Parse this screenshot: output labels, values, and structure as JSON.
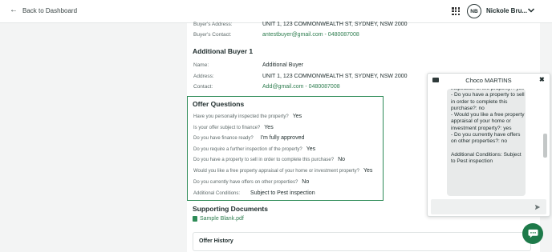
{
  "topbar": {
    "back_label": "Back to Dashboard",
    "avatar_initials": "NB",
    "username": "Nickole Bru..."
  },
  "buyer": {
    "address_label": "Buyer's Address:",
    "address": "UNIT 1, 123 COMMONWEALTH ST, SYDNEY, NSW 2000",
    "contact_label": "Buyer's Contact:",
    "contact": "antestbuyer@gmail.com - 0480087008"
  },
  "additional_buyer": {
    "heading": "Additional Buyer 1",
    "name_label": "Name:",
    "name": "Additional Buyer",
    "address_label": "Address:",
    "address": "UNIT 1, 123 COMMONWEALTH ST, SYDNEY, NSW 2000",
    "contact_label": "Contact:",
    "contact": "Add@gmail.com - 0480087008"
  },
  "offer_questions": {
    "heading": "Offer Questions",
    "items": [
      {
        "q": "Have you personally inspected the property?",
        "a": "Yes"
      },
      {
        "q": "Is your offer subject to finance?",
        "a": "Yes"
      },
      {
        "q": "Do you have finance ready?",
        "a": "I'm fully approved"
      },
      {
        "q": "Do you require a further inspection of the property?",
        "a": "Yes"
      },
      {
        "q": "Do you have a property to sell in order to complete this purchase?",
        "a": "No"
      },
      {
        "q": "Would you like a free property appraisal of your home or investment property?",
        "a": "Yes"
      },
      {
        "q": "Do you currently have offers on other properties?",
        "a": "No"
      }
    ],
    "conditions_label": "Additional Conditions:",
    "conditions": "Subject to Pest inspection"
  },
  "supporting_docs": {
    "heading": "Supporting Documents",
    "file": "Sample Blank.pdf"
  },
  "offer_history": {
    "title": "Offer History"
  },
  "chat": {
    "title": "Choco MARTINS",
    "message": "inspection of the property?: yes\n- Do you have a property to sell in order to complete this purchase?: no\n- Would you like a free property appraisal of your home or investment property?: yes\n- Do you currently have offers on other properties?: no\n\nAdditional Conditions: Subject to Pest inspection",
    "input_placeholder": ""
  },
  "colors": {
    "accent_green": "#2e8b57",
    "fab_green": "#1e7a4a",
    "background": "#f3f4f4"
  }
}
